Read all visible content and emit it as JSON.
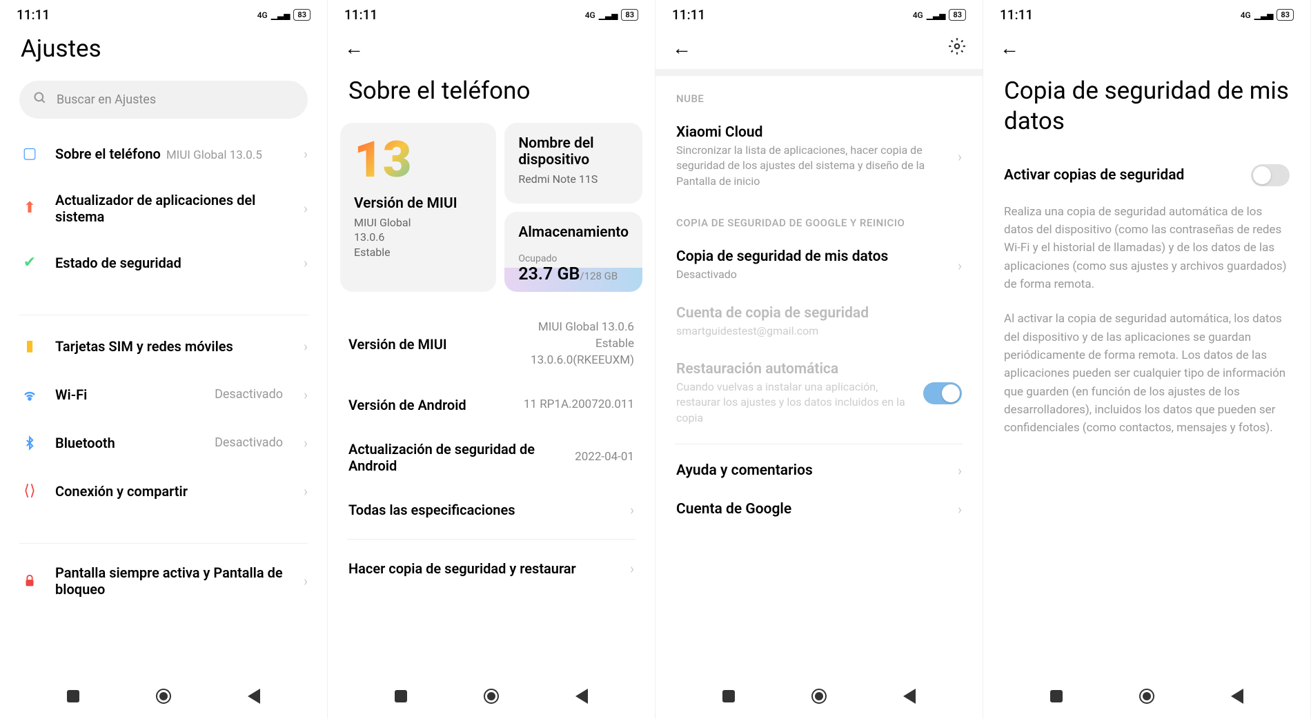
{
  "status": {
    "time": "11:11",
    "network": "4G",
    "battery": "83"
  },
  "screen1": {
    "title": "Ajustes",
    "search_placeholder": "Buscar en Ajustes",
    "items": {
      "about": {
        "label": "Sobre el teléfono",
        "meta": "MIUI Global 13.0.5"
      },
      "updater": {
        "label": "Actualizador de aplicaciones del sistema"
      },
      "security": {
        "label": "Estado de seguridad"
      },
      "sim": {
        "label": "Tarjetas SIM y redes móviles"
      },
      "wifi": {
        "label": "Wi-Fi",
        "value": "Desactivado"
      },
      "bluetooth": {
        "label": "Bluetooth",
        "value": "Desactivado"
      },
      "share": {
        "label": "Conexión y compartir"
      },
      "lockscreen": {
        "label": "Pantalla siempre activa y Pantalla de bloqueo"
      }
    }
  },
  "screen2": {
    "title": "Sobre el teléfono",
    "miui_logo": "13",
    "miui_card": {
      "title": "Versión de MIUI",
      "sub1": "MIUI Global",
      "sub2": "13.0.6",
      "sub3": "Estable"
    },
    "device_card": {
      "title": "Nombre del dispositivo",
      "sub": "Redmi Note 11S"
    },
    "storage_card": {
      "title": "Almacenamiento",
      "label": "Ocupado",
      "used": "23.7 GB",
      "total": "/128 GB"
    },
    "rows": {
      "miui": {
        "label": "Versión de MIUI",
        "v1": "MIUI Global 13.0.6",
        "v2": "Estable",
        "v3": "13.0.6.0(RKEEUXM)"
      },
      "android": {
        "label": "Versión de Android",
        "value": "11 RP1A.200720.011"
      },
      "patch": {
        "label": "Actualización de seguridad de Android",
        "value": "2022-04-01"
      },
      "specs": {
        "label": "Todas las especificaciones"
      },
      "backup": {
        "label": "Hacer copia de seguridad y restaurar"
      }
    }
  },
  "screen3": {
    "section_cloud": "NUBE",
    "cloud": {
      "title": "Xiaomi Cloud",
      "desc": "Sincronizar la lista de aplicaciones, hacer copia de seguridad de los ajustes del sistema y diseño de la Pantalla de inicio"
    },
    "section_google": "COPIA DE SEGURIDAD DE GOOGLE Y REINICIO",
    "backup_data": {
      "title": "Copia de seguridad de mis datos",
      "desc": "Desactivado"
    },
    "account": {
      "title": "Cuenta de copia de seguridad",
      "desc": "smartguidestest@gmail.com"
    },
    "auto_restore": {
      "title": "Restauración automática",
      "desc": "Cuando vuelvas a instalar una aplicación, restaurar los ajustes y los datos incluidos en la copia"
    },
    "help": {
      "title": "Ayuda y comentarios"
    },
    "google": {
      "title": "Cuenta de Google"
    }
  },
  "screen4": {
    "title": "Copia de seguridad de mis datos",
    "toggle_label": "Activar copias de seguridad",
    "para1": "Realiza una copia de seguridad automática de los datos del dispositivo (como las contraseñas de redes Wi-Fi y el historial de llamadas) y de los datos de las aplicaciones (como sus ajustes y archivos guardados) de forma remota.",
    "para2": "Al activar la copia de seguridad automática, los datos del dispositivo y de las aplicaciones se guardan periódicamente de forma remota. Los datos de las aplicaciones pueden ser cualquier tipo de información que guarden (en función de los ajustes de los desarrolladores), incluidos los datos que pueden ser confidenciales (como contactos, mensajes y fotos)."
  }
}
